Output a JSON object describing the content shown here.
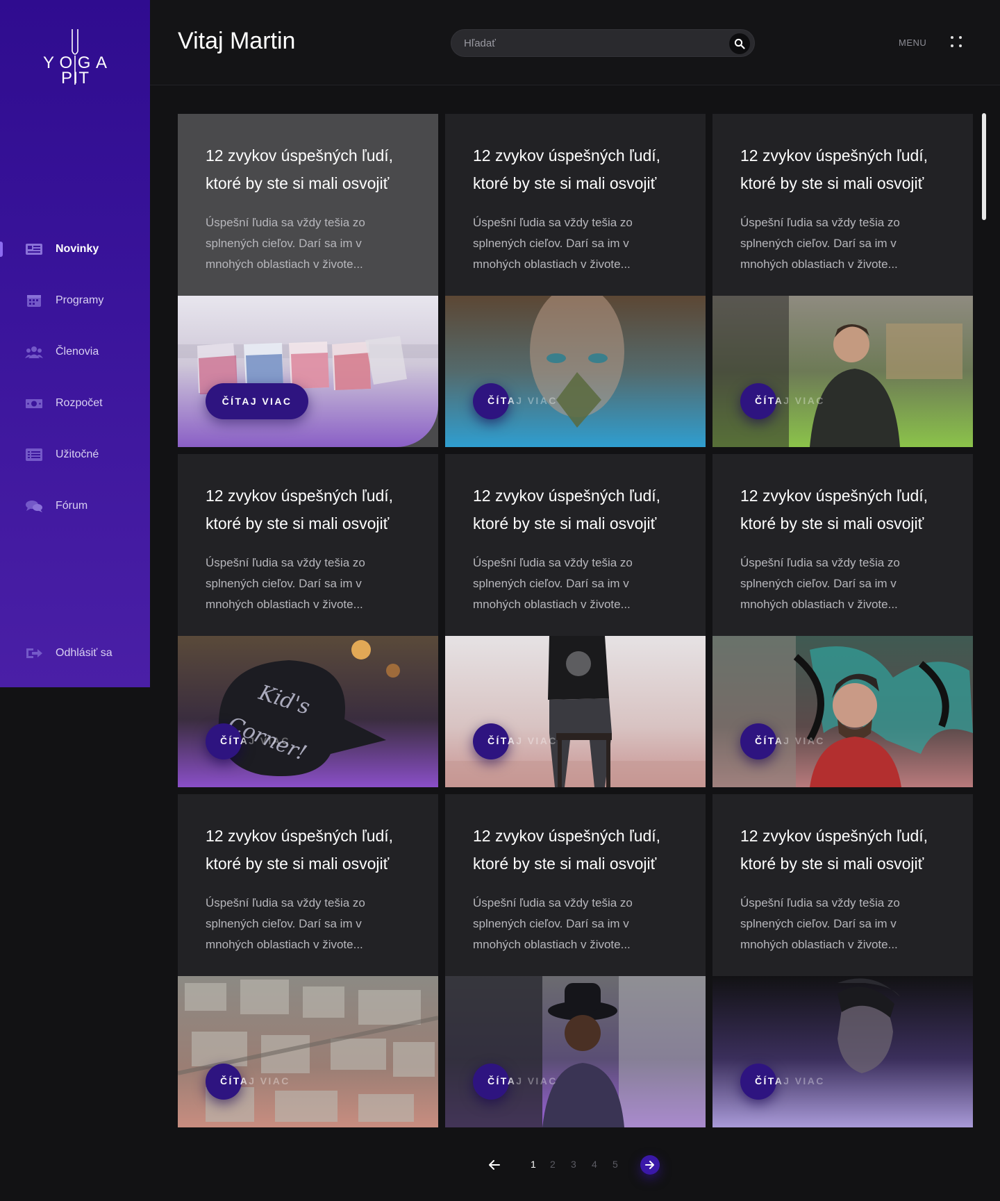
{
  "app": {
    "logo_text_top": "YOGA",
    "logo_text_bottom": "PIT"
  },
  "header": {
    "welcome": "Vitaj Martin",
    "search_placeholder": "Hľadať",
    "menu_label": "MENU"
  },
  "sidebar": {
    "items": [
      {
        "label": "Novinky",
        "icon": "newspaper-icon",
        "active": true
      },
      {
        "label": "Programy",
        "icon": "calendar-icon",
        "active": false
      },
      {
        "label": "Členovia",
        "icon": "users-icon",
        "active": false
      },
      {
        "label": "Rozpočet",
        "icon": "money-icon",
        "active": false
      },
      {
        "label": "Užitočné",
        "icon": "list-icon",
        "active": false
      },
      {
        "label": "Fórum",
        "icon": "chat-icon",
        "active": false
      }
    ],
    "logout_label": "Odhlásiť sa"
  },
  "cards": [
    {
      "title": "12 zvykov úspešných ľudí, ktoré by ste si mali osvojiť",
      "desc": "Úspešní ľudia sa vždy tešia zo splnených cieľov. Darí sa im v mnohých oblastiach v živote...",
      "button": "ČÍTAJ VIAC",
      "image": "beach-chairs"
    },
    {
      "title": "12 zvykov úspešných ľudí, ktoré by ste si mali osvojiť",
      "desc": "Úspešní ľudia sa vždy tešia zo splnených cieľov. Darí sa im v mnohých oblastiach v živote...",
      "button": "ČÍTAJ VIAC",
      "image": "woman-leaf"
    },
    {
      "title": "12 zvykov úspešných ľudí, ktoré by ste si mali osvojiť",
      "desc": "Úspešní ľudia sa vždy tešia zo splnených cieľov. Darí sa im v mnohých oblastiach v živote...",
      "button": "ČÍTAJ VIAC",
      "image": "barista"
    },
    {
      "title": "12 zvykov úspešných ľudí, ktoré by ste si mali osvojiť",
      "desc": "Úspešní ľudia sa vždy tešia zo splnených cieľov. Darí sa im v mnohých oblastiach v živote...",
      "button": "ČÍTAJ VIAC",
      "image": "kids-corner"
    },
    {
      "title": "12 zvykov úspešných ľudí, ktoré by ste si mali osvojiť",
      "desc": "Úspešní ľudia sa vždy tešia zo splnených cieľov. Darí sa im v mnohých oblastiach v živote...",
      "button": "ČÍTAJ VIAC",
      "image": "woman-stool"
    },
    {
      "title": "12 zvykov úspešných ľudí, ktoré by ste si mali osvojiť",
      "desc": "Úspešní ľudia sa vždy tešia zo splnených cieľov. Darí sa im v mnohých oblastiach v živote...",
      "button": "ČÍTAJ VIAC",
      "image": "graffiti-man"
    },
    {
      "title": "12 zvykov úspešných ľudí, ktoré by ste si mali osvojiť",
      "desc": "Úspešní ľudia sa vždy tešia zo splnených cieľov. Darí sa im v mnohých oblastiach v živote...",
      "button": "ČÍTAJ VIAC",
      "image": "city-aerial"
    },
    {
      "title": "12 zvykov úspešných ľudí, ktoré by ste si mali osvojiť",
      "desc": "Úspešní ľudia sa vždy tešia zo splnených cieľov. Darí sa im v mnohých oblastiach v živote...",
      "button": "ČÍTAJ VIAC",
      "image": "man-hat"
    },
    {
      "title": "12 zvykov úspešných ľudí, ktoré by ste si mali osvojiť",
      "desc": "Úspešní ľudia sa vždy tešia zo splnených cieľov. Darí sa im v mnohých oblastiach v živote...",
      "button": "ČÍTAJ VIAC",
      "image": "man-dark"
    }
  ],
  "pagination": {
    "pages": [
      "1",
      "2",
      "3",
      "4",
      "5"
    ],
    "current": "1"
  },
  "colors": {
    "sidebar_top": "#2f0c8f",
    "sidebar_bottom": "#4a1fa6",
    "accent": "#2e1480",
    "background": "#121214",
    "card": "#222225"
  }
}
